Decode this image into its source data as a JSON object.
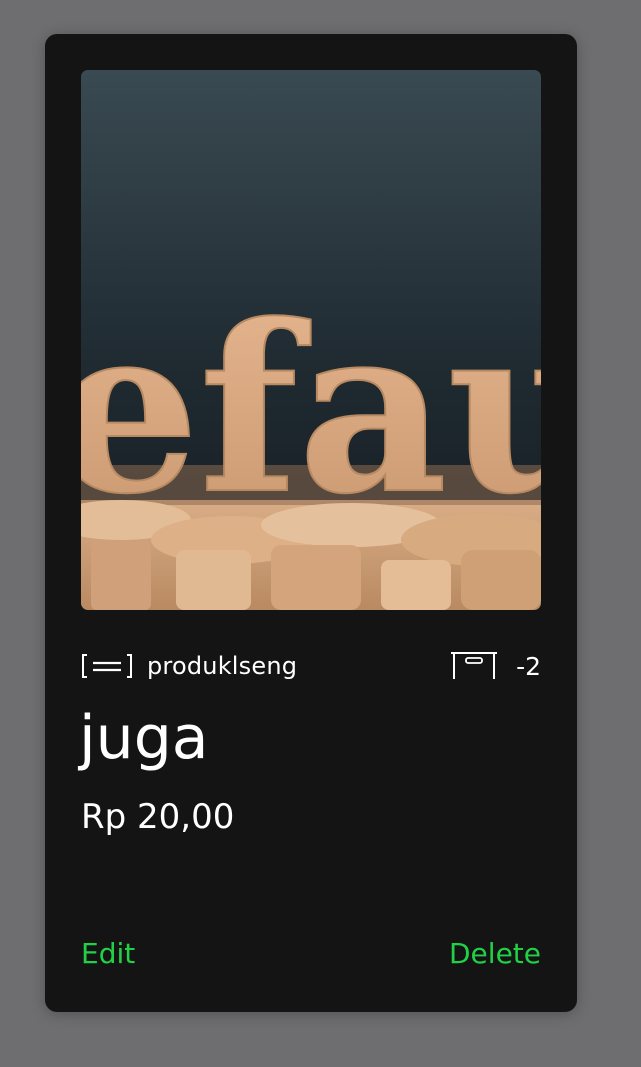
{
  "product": {
    "image_icon": "default-image-wooden-letters",
    "image_lettering": "efau",
    "category_icon": "category-icon",
    "category": "produklseng",
    "stock_icon": "stock-box-icon",
    "stock": "-2",
    "name": "juga",
    "price": "Rp 20,00"
  },
  "actions": {
    "edit_label": "Edit",
    "delete_label": "Delete"
  },
  "colors": {
    "background": "#6e6e70",
    "card": "#141414",
    "text": "#ffffff",
    "action": "#22d046"
  }
}
